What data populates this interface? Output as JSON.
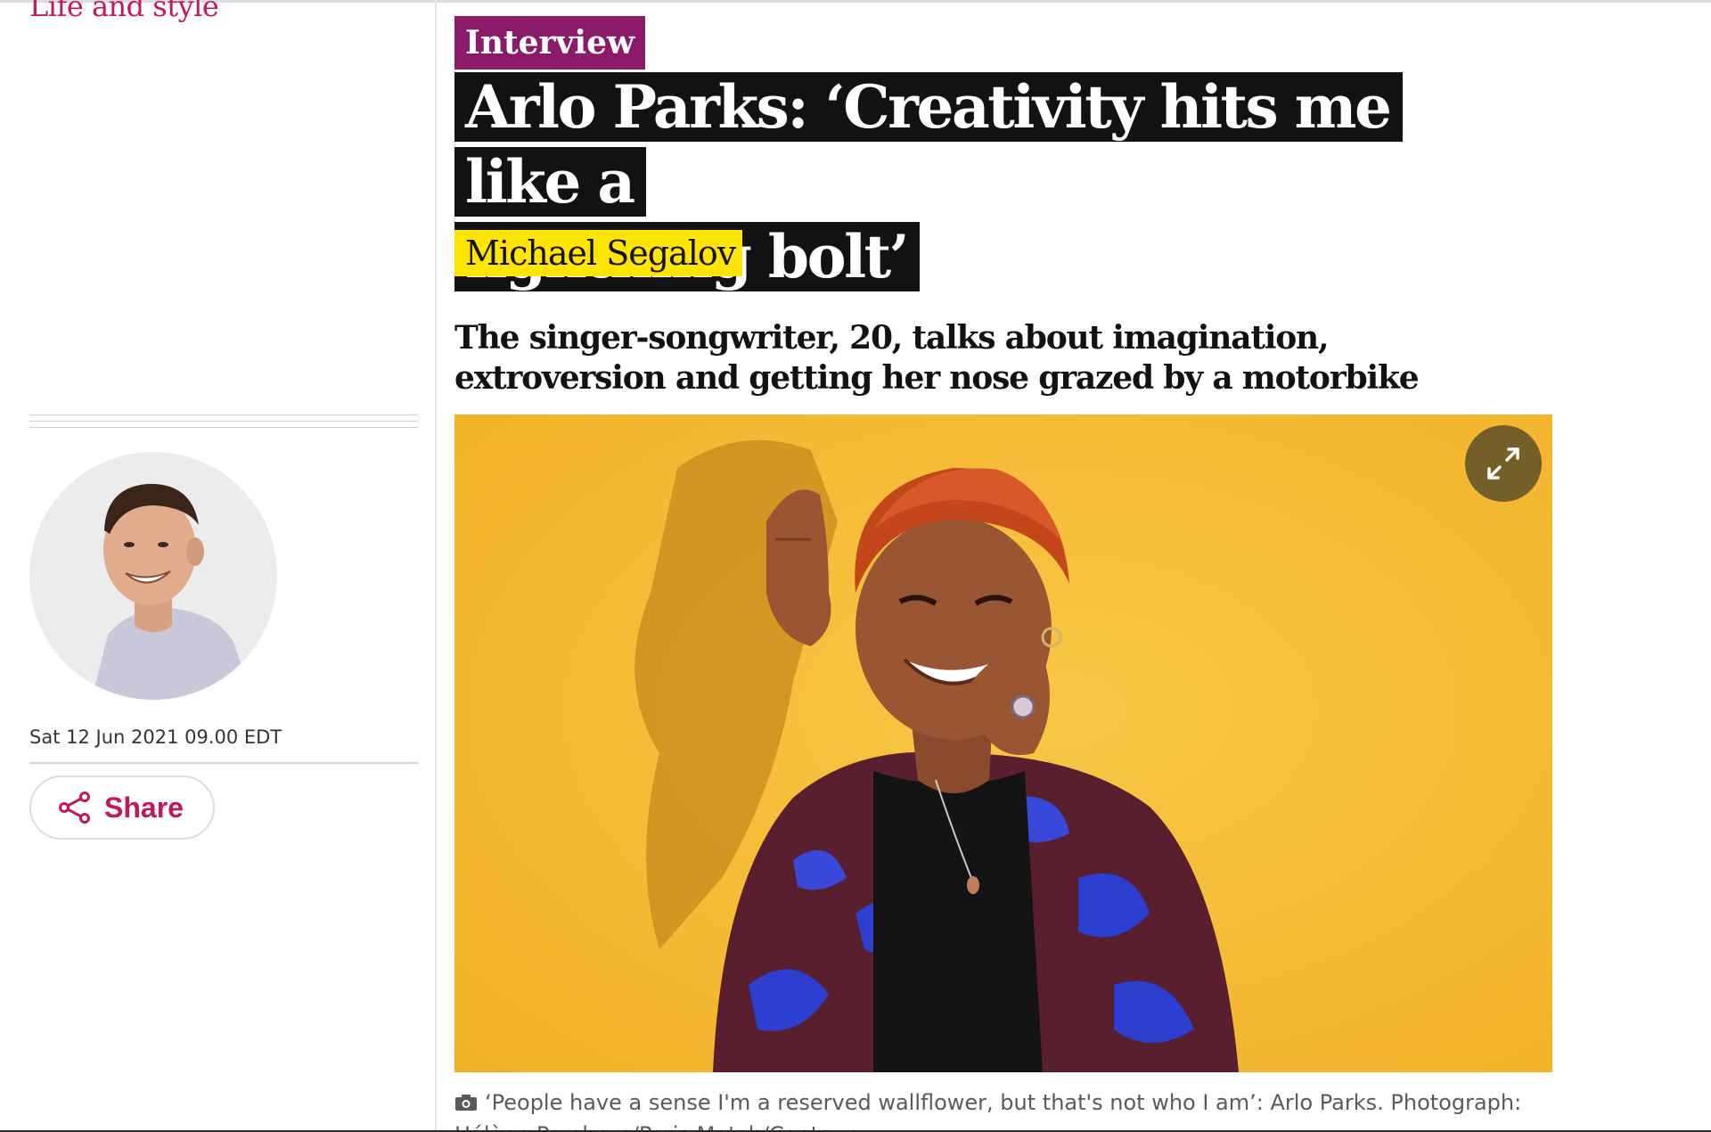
{
  "section": {
    "label": "Life and style"
  },
  "article": {
    "kicker": "Interview",
    "headline_line1": "Arlo Parks: ‘Creativity hits me like a",
    "headline_line2": "lightning bolt’",
    "byline": "Michael Segalov",
    "standfirst_line1": "The singer-songwriter, 20, talks about imagination,",
    "standfirst_line2": "extroversion and getting her nose grazed by a motorbike",
    "dateline": "Sat 12 Jun 2021 09.00 EDT",
    "caption": "‘People have a sense I'm a reserved wallflower, but that's not who I am’: Arlo Parks. Photograph: Hélène Pambrun/Paris Match/Contour"
  },
  "share": {
    "label": "Share",
    "icon": "share-icon"
  },
  "media": {
    "expand_icon": "expand-icon",
    "camera_icon": "camera-icon"
  },
  "colors": {
    "section_accent": "#c2185b",
    "kicker_bg": "#8b1a6b",
    "headline_bg": "#121212",
    "byline_bg": "#ffe500",
    "photo_bg": "#f5b82e"
  }
}
